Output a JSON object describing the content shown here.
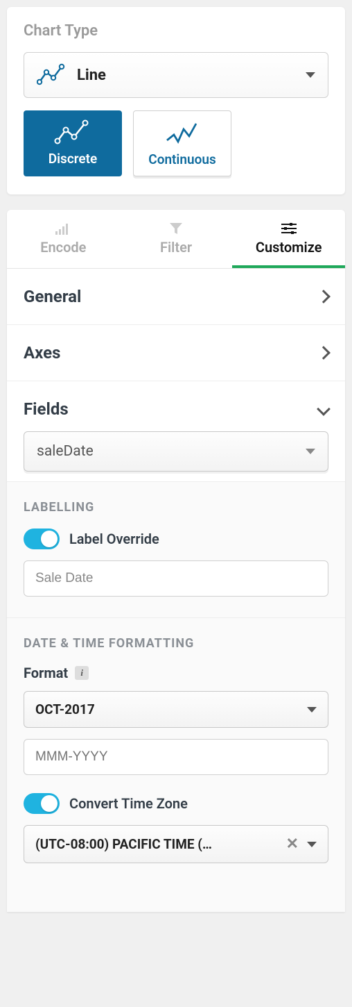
{
  "chartType": {
    "title": "Chart Type",
    "selected": "Line",
    "modes": {
      "discrete": "Discrete",
      "continuous": "Continuous"
    }
  },
  "tabs": {
    "encode": "Encode",
    "filter": "Filter",
    "customize": "Customize"
  },
  "accordion": {
    "general": "General",
    "axes": "Axes",
    "fields": "Fields",
    "fieldSelected": "saleDate"
  },
  "labelling": {
    "heading": "LABELLING",
    "toggleLabel": "Label Override",
    "value": "Sale Date"
  },
  "datetime": {
    "heading": "DATE & TIME FORMATTING",
    "formatLabel": "Format",
    "formatValue": "OCT-2017",
    "patternPlaceholder": "MMM-YYYY",
    "convertLabel": "Convert Time Zone",
    "tzValue": "(UTC-08:00) PACIFIC TIME (…"
  }
}
